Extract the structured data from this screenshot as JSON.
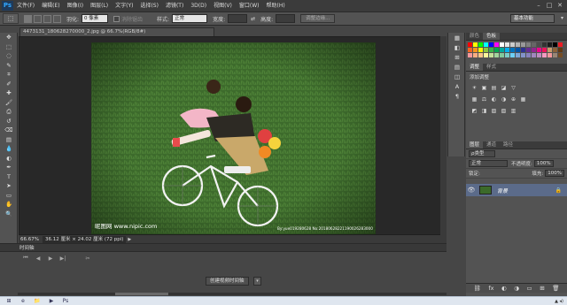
{
  "app": {
    "logo": "Ps"
  },
  "menu": [
    "文件(F)",
    "编辑(E)",
    "图像(I)",
    "图层(L)",
    "文字(Y)",
    "选择(S)",
    "滤镜(T)",
    "3D(D)",
    "视图(V)",
    "窗口(W)",
    "帮助(H)"
  ],
  "window_controls": [
    "–",
    "□",
    "✕"
  ],
  "options": {
    "feather_label": "羽化:",
    "feather_value": "0 像素",
    "antialias_label": "消除锯齿",
    "style_label": "样式:",
    "style_value": "正常",
    "width_label": "宽度:",
    "height_label": "高度:",
    "refine_button": "调整边缘...",
    "workspace": "基本功能"
  },
  "toolbar_icons": [
    "move-icon",
    "marquee-icon",
    "lasso-icon",
    "quick-select-icon",
    "crop-icon",
    "eyedropper-icon",
    "healing-icon",
    "brush-icon",
    "stamp-icon",
    "history-brush-icon",
    "eraser-icon",
    "gradient-icon",
    "blur-icon",
    "dodge-icon",
    "pen-icon",
    "type-icon",
    "path-select-icon",
    "shape-icon",
    "hand-icon",
    "zoom-icon"
  ],
  "toolbar_glyphs": [
    "✥",
    "⬚",
    "◌",
    "✎",
    "⌗",
    "✐",
    "✚",
    "🖌",
    "⎙",
    "↺",
    "⌫",
    "▤",
    "💧",
    "◐",
    "✒",
    "T",
    "➤",
    "▭",
    "✋",
    "🔍"
  ],
  "document": {
    "tab_title": "4473131_180628270000_2.jpg @ 66.7%(RGB/8#)",
    "zoom": "66.67%",
    "info": "36.12 厘米 × 24.02 厘米 (72 ppi)",
    "watermark_left": "昵图网 www.nipic.com",
    "watermark_right": "By:yue019280628  No:20180628221190026283000"
  },
  "timeline": {
    "title": "时间轴",
    "controls": [
      "⏮",
      "◀",
      "▶",
      "▶|",
      "✂"
    ],
    "create_button": "创建视频时间轴",
    "create_arrow": "▾"
  },
  "dock_icons": [
    "▦",
    "◧",
    "⊞",
    "▤",
    "◫",
    "A",
    "¶"
  ],
  "panels": {
    "color_tabs": [
      "颜色",
      "色板"
    ],
    "adj_tabs": [
      "调整",
      "样式"
    ],
    "adj_title": "添加调整",
    "adj_row1": [
      "☀",
      "▣",
      "▤",
      "◪",
      "▽"
    ],
    "adj_row2": [
      "▦",
      "⚖",
      "◐",
      "◑",
      "⊕",
      "▦"
    ],
    "adj_row3": [
      "◩",
      "◨",
      "▨",
      "▧",
      "▥"
    ],
    "layers_tabs": [
      "图层",
      "通道",
      "路径"
    ],
    "kind_label": "ρ类型",
    "blend_mode": "正常",
    "opacity_label": "不透明度:",
    "opacity_value": "100%",
    "lock_label": "锁定:",
    "fill_label": "填充:",
    "fill_value": "100%",
    "layer_name": "背景",
    "footer_icons": [
      "⛓",
      "fx",
      "◐",
      "◑",
      "▭",
      "⊞",
      "🗑"
    ]
  },
  "taskbar_icons": [
    "⊞",
    "e",
    "📁",
    "▶",
    "Ps"
  ],
  "swatch_colors": [
    "#ff0000",
    "#ffff00",
    "#00ff00",
    "#00ffff",
    "#0000ff",
    "#ff00ff",
    "#ffffff",
    "#e6e6e6",
    "#cccccc",
    "#b3b3b3",
    "#999999",
    "#808080",
    "#666666",
    "#4d4d4d",
    "#333333",
    "#1a1a1a",
    "#000000",
    "#ed1c24",
    "#f26522",
    "#f7941d",
    "#fff200",
    "#8dc63f",
    "#39b54a",
    "#00a651",
    "#00a99d",
    "#00aeef",
    "#0072bc",
    "#0054a6",
    "#2e3192",
    "#662d91",
    "#92278f",
    "#ec008c",
    "#ed145b",
    "#c69c6d",
    "#8c6239",
    "#603813",
    "#f5989d",
    "#f9ad81",
    "#fdc68a",
    "#fff799",
    "#c4df9b",
    "#a3d39c",
    "#82ca9c",
    "#7accc8",
    "#6dcff6",
    "#7da7d9",
    "#8393ca",
    "#8781bd",
    "#a186be",
    "#bd8cbf",
    "#f49ac1",
    "#f6989d",
    "#998675",
    "#754c24"
  ]
}
